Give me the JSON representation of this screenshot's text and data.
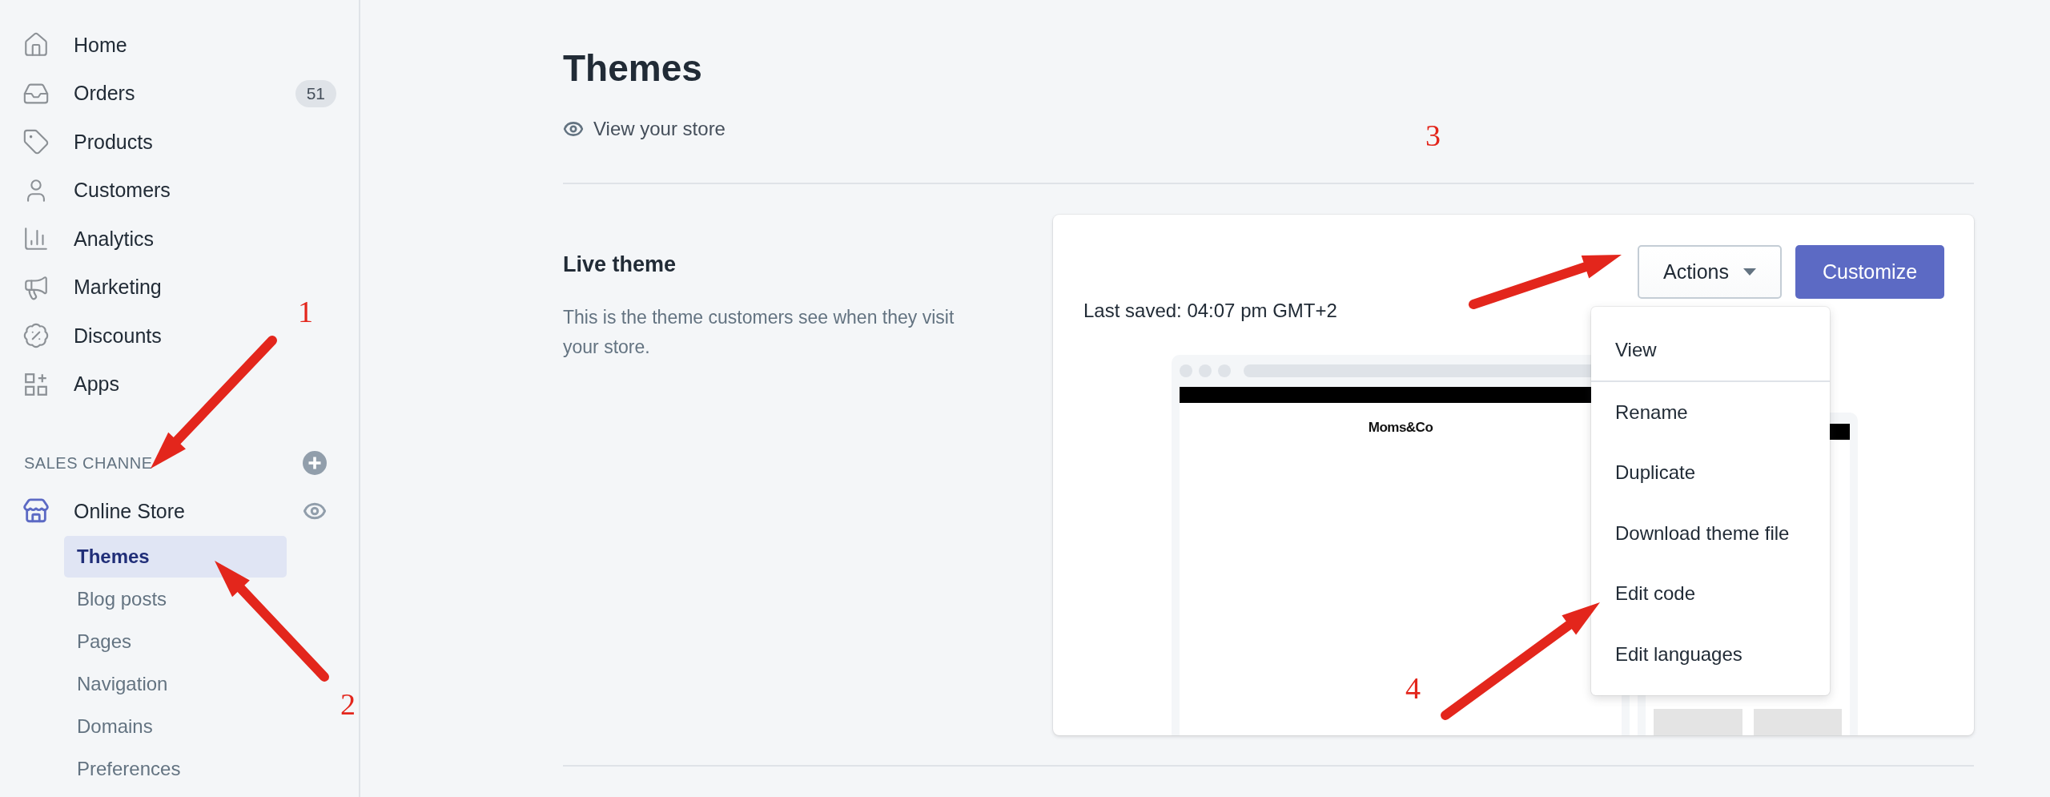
{
  "sidebar": {
    "items": [
      {
        "label": "Home"
      },
      {
        "label": "Orders",
        "badge": "51"
      },
      {
        "label": "Products"
      },
      {
        "label": "Customers"
      },
      {
        "label": "Analytics"
      },
      {
        "label": "Marketing"
      },
      {
        "label": "Discounts"
      },
      {
        "label": "Apps"
      }
    ],
    "section_title": "SALES CHANNE",
    "channel": {
      "label": "Online Store"
    },
    "sub_items": [
      {
        "label": "Themes",
        "selected": true
      },
      {
        "label": "Blog posts",
        "selected": false
      },
      {
        "label": "Pages",
        "selected": false
      },
      {
        "label": "Navigation",
        "selected": false
      },
      {
        "label": "Domains",
        "selected": false
      },
      {
        "label": "Preferences",
        "selected": false
      }
    ]
  },
  "page": {
    "title": "Themes",
    "view_link": "View your store"
  },
  "live_theme": {
    "heading": "Live theme",
    "description": "This is the theme customers see when they visit your store.",
    "last_saved": "Last saved: 04:07 pm GMT+2",
    "actions_button": "Actions",
    "customize_button": "Customize",
    "preview": {
      "logo": "Moms&Co"
    },
    "menu": [
      {
        "label": "View",
        "divider": true
      },
      {
        "label": "Rename",
        "divider": false
      },
      {
        "label": "Duplicate",
        "divider": false
      },
      {
        "label": "Download theme file",
        "divider": false
      },
      {
        "label": "Edit code",
        "divider": false
      },
      {
        "label": "Edit languages",
        "divider": false
      }
    ]
  },
  "annotations": [
    {
      "label": "1"
    },
    {
      "label": "2"
    },
    {
      "label": "3"
    },
    {
      "label": "4"
    }
  ]
}
